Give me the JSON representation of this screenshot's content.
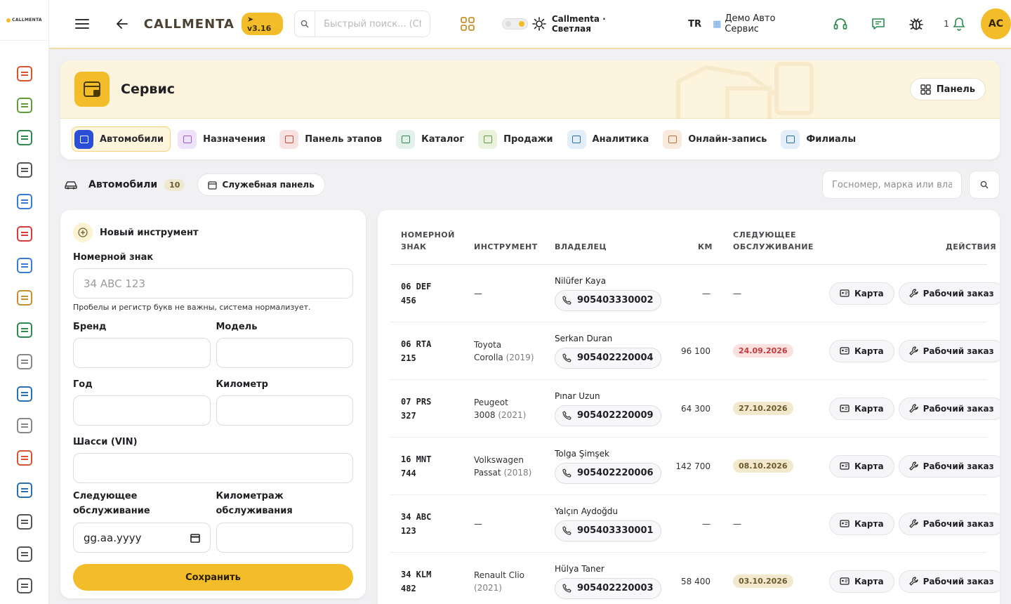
{
  "rail": {
    "logo": "CALLMENTA",
    "items": [
      {
        "name": "rail-calendar-grid",
        "icon": "calendar-grid-icon",
        "color": "#d9552f"
      },
      {
        "name": "rail-clipboard",
        "icon": "clipboard-icon",
        "color": "#5f9e3a"
      },
      {
        "name": "rail-cards",
        "icon": "id-cards-icon",
        "color": "#2f8a4e"
      },
      {
        "name": "rail-transfer",
        "icon": "transfer-icon",
        "color": "#555555"
      },
      {
        "name": "rail-user-circle",
        "icon": "user-circle-icon",
        "color": "#3a7bd5"
      },
      {
        "name": "rail-alarm",
        "icon": "alarm-icon",
        "color": "#d93a3a"
      },
      {
        "name": "rail-user-chat",
        "icon": "user-chat-icon",
        "color": "#3a7bd5"
      },
      {
        "name": "rail-medal",
        "icon": "medal-icon",
        "color": "#c7902d"
      },
      {
        "name": "rail-megaphone",
        "icon": "megaphone-icon",
        "color": "#2f8a4e"
      },
      {
        "name": "rail-gear",
        "icon": "gear-icon",
        "color": "#888888"
      },
      {
        "name": "rail-keypad",
        "icon": "keypad-icon",
        "color": "#2a6fb0"
      },
      {
        "name": "rail-shield",
        "icon": "shield-icon",
        "color": "#888888"
      },
      {
        "name": "rail-boxes",
        "icon": "boxes-icon",
        "color": "#d9552f"
      },
      {
        "name": "rail-analytics",
        "icon": "line-chart-icon",
        "color": "#2a6fb0"
      },
      {
        "name": "rail-globe",
        "icon": "globe-icon",
        "color": "#555555"
      },
      {
        "name": "rail-sliders",
        "icon": "sliders-icon",
        "color": "#555555"
      },
      {
        "name": "rail-report",
        "icon": "bar-report-icon",
        "color": "#555555"
      },
      {
        "name": "rail-warning",
        "icon": "warning-icon",
        "color": "#555555"
      }
    ]
  },
  "topbar": {
    "brand": "CALLMENTA",
    "version": "v3.16",
    "search_placeholder": "Быстрый поиск... (Ctrl+K)",
    "theme_label": "Callmenta · Светлая",
    "lang": "TR",
    "company": "Демо Авто Сервис",
    "notif_count": "1",
    "avatar": "AC"
  },
  "module": {
    "title": "Сервис",
    "panel_label": "Панель",
    "tabs": [
      {
        "label": "Автомобили",
        "name": "tab-cars",
        "active": true,
        "bg": "#2a4fd6",
        "fg": "#ffffff"
      },
      {
        "label": "Назначения",
        "name": "tab-appointments",
        "active": false,
        "bg": "#efe3fb",
        "fg": "#9b5ad6"
      },
      {
        "label": "Панель этапов",
        "name": "tab-stage-board",
        "active": false,
        "bg": "#f8e1df",
        "fg": "#c94b3f"
      },
      {
        "label": "Каталог",
        "name": "tab-catalog",
        "active": false,
        "bg": "#e2f2ea",
        "fg": "#2f8a4e"
      },
      {
        "label": "Продажи",
        "name": "tab-sales",
        "active": false,
        "bg": "#eaf2dd",
        "fg": "#5f9e3a"
      },
      {
        "label": "Аналитика",
        "name": "tab-analytics",
        "active": false,
        "bg": "#e3eef8",
        "fg": "#2a6fb0"
      },
      {
        "label": "Онлайн-запись",
        "name": "tab-online-booking",
        "active": false,
        "bg": "#f8eadc",
        "fg": "#c7702d"
      },
      {
        "label": "Филиалы",
        "name": "tab-branches",
        "active": false,
        "bg": "#e3eef8",
        "fg": "#2a6fb0"
      }
    ]
  },
  "sub": {
    "title": "Автомобили",
    "count": "10",
    "service_panel": "Служебная панель",
    "search_placeholder": "Госномер, марка или владелец"
  },
  "form": {
    "title": "Новый инструмент",
    "plate_label": "Номерной знак",
    "plate_placeholder": "34 ABC 123",
    "plate_hint": "Пробелы и регистр букв не важны, система нормализует.",
    "brand_label": "Бренд",
    "model_label": "Модель",
    "year_label": "Год",
    "km_label": "Километр",
    "vin_label": "Шасси (VIN)",
    "next_label": "Следующее обслуживание",
    "date_value": "gg.aa.yyyy",
    "service_km_label": "Километраж обслуживания",
    "save": "Сохранить"
  },
  "table": {
    "headers": {
      "plate_l1": "НОМЕРНОЙ",
      "plate_l2": "ЗНАК",
      "tool": "ИНСТРУМЕНТ",
      "owner": "ВЛАДЕЛЕЦ",
      "km": "КМ",
      "next_l1": "СЛЕДУЮЩЕЕ",
      "next_l2": "ОБСЛУЖИВАНИЕ",
      "actions": "ДЕЙСТВИЯ"
    },
    "card_label": "Карта",
    "work_order_label": "Рабочий заказ",
    "rows": [
      {
        "plate1": "06 DEF",
        "plate2": "456",
        "tool1": "—",
        "tool2": "",
        "year": "",
        "owner": "Nilüfer Kaya",
        "phone": "905403330002",
        "km": "—",
        "due": "—",
        "overdue": false
      },
      {
        "plate1": "06 RTA",
        "plate2": "215",
        "tool1": "Toyota",
        "tool2": "Corolla",
        "year": "(2019)",
        "owner": "Serkan Duran",
        "phone": "905402220004",
        "km": "96 100",
        "due": "24.09.2026",
        "overdue": true
      },
      {
        "plate1": "07 PRS",
        "plate2": "327",
        "tool1": "Peugeot",
        "tool2": "3008",
        "year": "(2021)",
        "owner": "Pınar Uzun",
        "phone": "905402220009",
        "km": "64 300",
        "due": "27.10.2026",
        "overdue": false
      },
      {
        "plate1": "16 MNT",
        "plate2": "744",
        "tool1": "Volkswagen",
        "tool2": "Passat",
        "year": "(2018)",
        "owner": "Tolga Şimşek",
        "phone": "905402220006",
        "km": "142 700",
        "due": "08.10.2026",
        "overdue": false
      },
      {
        "plate1": "34 ABC",
        "plate2": "123",
        "tool1": "—",
        "tool2": "",
        "year": "",
        "owner": "Yalçın Aydoğdu",
        "phone": "905403330001",
        "km": "—",
        "due": "—",
        "overdue": false
      },
      {
        "plate1": "34 KLM",
        "plate2": "482",
        "tool1": "Renault Clio",
        "tool2": "",
        "year": "(2021)",
        "owner": "Hülya Taner",
        "phone": "905402220003",
        "km": "58 400",
        "due": "03.10.2026",
        "overdue": false
      }
    ]
  }
}
